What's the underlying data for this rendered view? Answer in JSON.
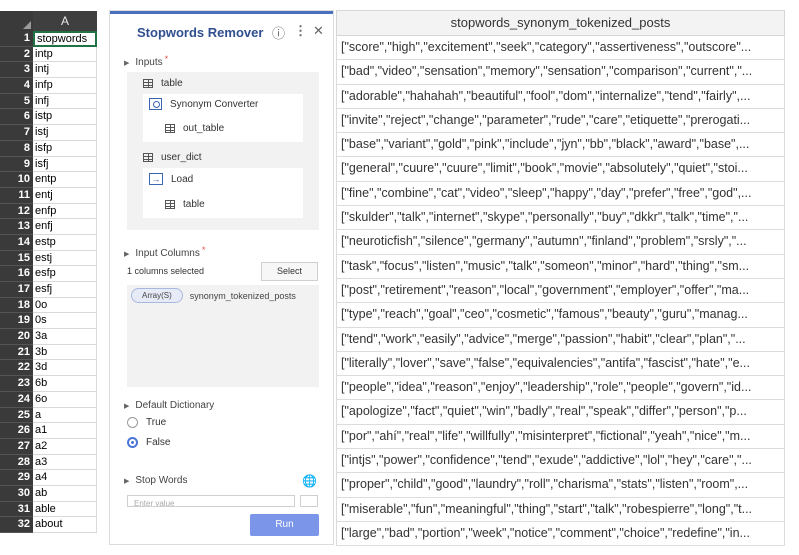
{
  "sheet": {
    "column_header": "A",
    "rows": [
      {
        "num": "1",
        "value": "stopwords"
      },
      {
        "num": "2",
        "value": "intp"
      },
      {
        "num": "3",
        "value": "intj"
      },
      {
        "num": "4",
        "value": "infp"
      },
      {
        "num": "5",
        "value": "infj"
      },
      {
        "num": "6",
        "value": "istp"
      },
      {
        "num": "7",
        "value": "istj"
      },
      {
        "num": "8",
        "value": "isfp"
      },
      {
        "num": "9",
        "value": "isfj"
      },
      {
        "num": "10",
        "value": "entp"
      },
      {
        "num": "11",
        "value": "entj"
      },
      {
        "num": "12",
        "value": "enfp"
      },
      {
        "num": "13",
        "value": "enfj"
      },
      {
        "num": "14",
        "value": "estp"
      },
      {
        "num": "15",
        "value": "estj"
      },
      {
        "num": "16",
        "value": "esfp"
      },
      {
        "num": "17",
        "value": "esfj"
      },
      {
        "num": "18",
        "value": "0o"
      },
      {
        "num": "19",
        "value": "0s"
      },
      {
        "num": "20",
        "value": "3a"
      },
      {
        "num": "21",
        "value": "3b"
      },
      {
        "num": "22",
        "value": "3d"
      },
      {
        "num": "23",
        "value": "6b"
      },
      {
        "num": "24",
        "value": "6o"
      },
      {
        "num": "25",
        "value": "a"
      },
      {
        "num": "26",
        "value": "a1"
      },
      {
        "num": "27",
        "value": "a2"
      },
      {
        "num": "28",
        "value": "a3"
      },
      {
        "num": "29",
        "value": "a4"
      },
      {
        "num": "30",
        "value": "ab"
      },
      {
        "num": "31",
        "value": "able"
      },
      {
        "num": "32",
        "value": "about"
      }
    ]
  },
  "panel": {
    "title": "Stopwords Remover",
    "inputs_label": "Inputs",
    "table_label": "table",
    "synonym_converter_label": "Synonym Converter",
    "out_table_label": "out_table",
    "user_dict_label": "user_dict",
    "load_label": "Load",
    "load_table_label": "table",
    "input_columns_label": "Input Columns",
    "columns_selected": "1 columns selected",
    "select_button": "Select",
    "column_type_badge": "Array(S)",
    "column_name": "synonym_tokenized_posts",
    "default_dictionary_label": "Default Dictionary",
    "true_label": "True",
    "false_label": "False",
    "stop_words_label": "Stop Words",
    "stop_words_placeholder": "Enter value",
    "run_button": "Run",
    "accent_color": "#2f4f8f"
  },
  "results": {
    "column_header": "stopwords_synonym_tokenized_posts",
    "rows": [
      "[\"score\",\"high\",\"excitement\",\"seek\",\"category\",\"assertiveness\",\"outscore\"...",
      "[\"bad\",\"video\",\"sensation\",\"memory\",\"sensation\",\"comparison\",\"current\",\"...",
      "[\"adorable\",\"hahahah\",\"beautiful\",\"fool\",\"dom\",\"internalize\",\"tend\",\"fairly\",...",
      "[\"invite\",\"reject\",\"change\",\"parameter\",\"rude\",\"care\",\"etiquette\",\"prerogati...",
      "[\"base\",\"variant\",\"gold\",\"pink\",\"include\",\"jyn\",\"bb\",\"black\",\"award\",\"base\",...",
      "[\"general\",\"cuure\",\"cuure\",\"limit\",\"book\",\"movie\",\"absolutely\",\"quiet\",\"stoi...",
      "[\"fine\",\"combine\",\"cat\",\"video\",\"sleep\",\"happy\",\"day\",\"prefer\",\"free\",\"god\",...",
      "[\"skulder\",\"talk\",\"internet\",\"skype\",\"personally\",\"buy\",\"dkkr\",\"talk\",\"time\",\"...",
      "[\"neuroticfish\",\"silence\",\"germany\",\"autumn\",\"finland\",\"problem\",\"srsly\",\"...",
      "[\"task\",\"focus\",\"listen\",\"music\",\"talk\",\"someon\",\"minor\",\"hard\",\"thing\",\"sm...",
      "[\"post\",\"retirement\",\"reason\",\"local\",\"government\",\"employer\",\"offer\",\"ma...",
      "[\"type\",\"reach\",\"goal\",\"ceo\",\"cosmetic\",\"famous\",\"beauty\",\"guru\",\"manag...",
      "[\"tend\",\"work\",\"easily\",\"advice\",\"merge\",\"passion\",\"habit\",\"clear\",\"plan\",\"...",
      "[\"literally\",\"lover\",\"save\",\"false\",\"equivalencies\",\"antifa\",\"fascist\",\"hate\",\"e...",
      "[\"people\",\"idea\",\"reason\",\"enjoy\",\"leadership\",\"role\",\"people\",\"govern\",\"id...",
      "[\"apologize\",\"fact\",\"quiet\",\"win\",\"badly\",\"real\",\"speak\",\"differ\",\"person\",\"p...",
      "[\"por\",\"ahí\",\"real\",\"life\",\"willfully\",\"misinterpret\",\"fictional\",\"yeah\",\"nice\",\"m...",
      "[\"intjs\",\"power\",\"confidence\",\"tend\",\"exude\",\"addictive\",\"lol\",\"hey\",\"care\",\"...",
      "[\"proper\",\"child\",\"good\",\"laundry\",\"roll\",\"charisma\",\"stats\",\"listen\",\"room\",...",
      "[\"miserable\",\"fun\",\"meaningful\",\"thing\",\"start\",\"talk\",\"robespierre\",\"long\",\"t...",
      "[\"large\",\"bad\",\"portion\",\"week\",\"notice\",\"comment\",\"choice\",\"redefine\",\"in..."
    ]
  }
}
